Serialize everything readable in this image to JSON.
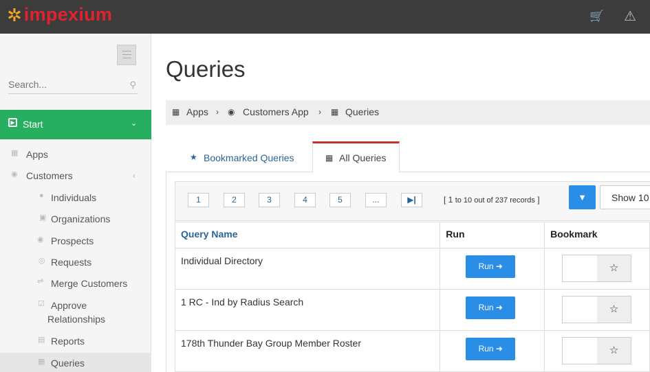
{
  "brand": {
    "logo_glyph": "✲",
    "name": "impexium",
    "accent": "#e0232e"
  },
  "topbar": {
    "cart_icon": "cart-icon",
    "alert_icon": "alert-icon"
  },
  "sidebar": {
    "search_placeholder": "Search...",
    "start_label": "Start",
    "items": [
      {
        "label": "Apps",
        "icon": "grid-icon"
      },
      {
        "label": "Customers",
        "icon": "users-icon"
      },
      {
        "label": "Individuals",
        "icon": "person-icon"
      },
      {
        "label": "Organizations",
        "icon": "building-icon"
      },
      {
        "label": "Prospects",
        "icon": "users-icon"
      },
      {
        "label": "Requests",
        "icon": "lifebuoy-icon"
      },
      {
        "label": "Merge Customers",
        "icon": "arrows-icon"
      },
      {
        "label": "Approve",
        "label2": "Relationships",
        "icon": "check-square-icon"
      },
      {
        "label": "Reports",
        "icon": "bar-chart-icon"
      },
      {
        "label": "Queries",
        "icon": "table-icon"
      }
    ]
  },
  "page": {
    "title": "Queries"
  },
  "breadcrumb": [
    "Apps",
    "Customers App",
    "Queries"
  ],
  "tabs": [
    "Bookmarked Queries",
    "All Queries"
  ],
  "pagination": {
    "pages": [
      "1",
      "2",
      "3",
      "4",
      "5",
      "..."
    ],
    "records_open": "[ 1 ",
    "records_mid": "to 10 out of 237 records",
    "records_close": " ]",
    "show_label": "Show 10"
  },
  "table": {
    "headers": [
      "Query Name",
      "Run",
      "Bookmark"
    ],
    "run_label": "Run",
    "rows": [
      "Individual Directory",
      "1 RC - Ind by Radius Search",
      "178th Thunder Bay Group Member Roster"
    ]
  }
}
